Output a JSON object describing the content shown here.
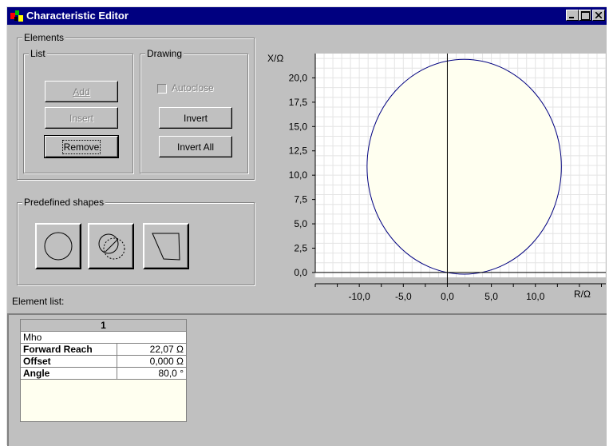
{
  "window": {
    "title": "Characteristic Editor"
  },
  "elements_group": {
    "label": "Elements",
    "list_group": {
      "label": "List",
      "add": "Add",
      "insert": "Insert",
      "remove": "Remove"
    },
    "drawing_group": {
      "label": "Drawing",
      "autoclose": "Autoclose",
      "invert": "Invert",
      "invert_all": "Invert All"
    }
  },
  "predefined": {
    "label": "Predefined shapes",
    "shapes": [
      "circle-shape-icon",
      "overlapping-circles-shape-icon",
      "polygon-shape-icon"
    ]
  },
  "element_list": {
    "label": "Element list:",
    "column": "1",
    "type": "Mho",
    "rows": [
      {
        "name": "Forward Reach",
        "value": "22,07",
        "unit": "Ω"
      },
      {
        "name": "Offset",
        "value": "0,000",
        "unit": "Ω"
      },
      {
        "name": "Angle",
        "value": "80,0",
        "unit": "°"
      }
    ]
  },
  "chart_data": {
    "type": "scatter",
    "xlabel": "R/Ω",
    "ylabel": "X/Ω",
    "xlim": [
      -15,
      18
    ],
    "ylim": [
      -0.5,
      22.5
    ],
    "xticks": [
      "-10,0",
      "-5,0",
      "0,0",
      "5,0",
      "10,0"
    ],
    "yticks": [
      "0,0",
      "2,5",
      "5,0",
      "7,5",
      "10,0",
      "12,5",
      "15,0",
      "17,5",
      "20,0"
    ],
    "shapes": [
      {
        "kind": "circle",
        "center": [
          1.916,
          10.866
        ],
        "radius": 11.035,
        "fill": "#fffff0",
        "stroke": "#000080"
      }
    ],
    "grid": true
  }
}
